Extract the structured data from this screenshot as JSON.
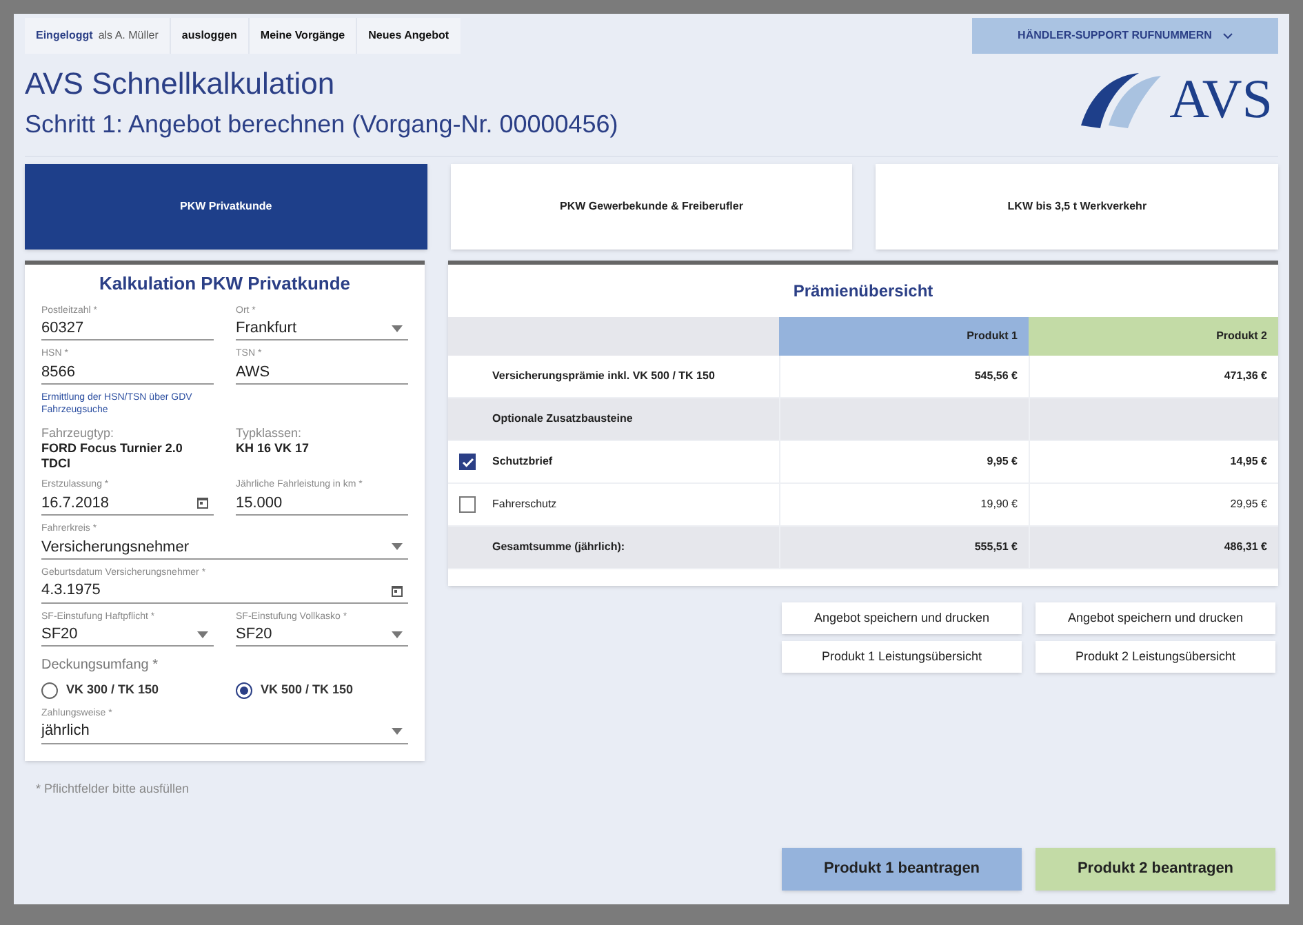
{
  "nav": {
    "logged_in_label": "Eingeloggt",
    "logged_in_user": "als A. Müller",
    "links": [
      "ausloggen",
      "Meine Vorgänge",
      "Neues Angebot"
    ],
    "support": "HÄNDLER-SUPPORT RUFNUMMERN"
  },
  "header": {
    "title": "AVS Schnellkalkulation",
    "subtitle": "Schritt 1: Angebot berechnen (Vorgang-Nr. 00000456)",
    "logo": "AVS"
  },
  "tabs": [
    {
      "label": "PKW Privatkunde",
      "selected": true
    },
    {
      "label": "PKW Gewerbekunde & Freiberufler",
      "selected": false
    },
    {
      "label": "LKW bis 3,5 t Werkverkehr",
      "selected": false
    }
  ],
  "form": {
    "title": "Kalkulation PKW Privatkunde",
    "items": [
      {
        "kind": "fields",
        "fields": [
          {
            "kind": "text",
            "label": "Postleitzahl *",
            "value": "60327"
          },
          {
            "kind": "select",
            "label": "Ort *",
            "value": "Frankfurt"
          }
        ]
      },
      {
        "kind": "fields",
        "fields": [
          {
            "kind": "text",
            "label": "HSN *",
            "value": "8566"
          },
          {
            "kind": "text",
            "label": "TSN *",
            "value": "AWS"
          }
        ]
      },
      {
        "kind": "link",
        "text": "Ermittlung der HSN/TSN über GDV Fahrzeugsuche"
      },
      {
        "kind": "info",
        "pairs": [
          {
            "label": "Fahrzeugtyp:",
            "value": "FORD Focus Turnier 2.0 TDCI"
          },
          {
            "label": "Typklassen:",
            "value": "KH 16 VK 17"
          }
        ]
      },
      {
        "kind": "fields",
        "fields": [
          {
            "kind": "date",
            "label": "Erstzulassung *",
            "value": "16.7.2018"
          },
          {
            "kind": "text",
            "label": "Jährliche Fahrleistung in km *",
            "value": "15.000"
          }
        ]
      },
      {
        "kind": "fields",
        "fields": [
          {
            "kind": "select",
            "label": "Fahrerkreis *",
            "value": "Versicherungsnehmer"
          }
        ]
      },
      {
        "kind": "fields",
        "fields": [
          {
            "kind": "date",
            "label": "Geburtsdatum Versicherungsnehmer *",
            "value": "4.3.1975"
          }
        ]
      },
      {
        "kind": "fields",
        "fields": [
          {
            "kind": "select",
            "label": "SF-Einstufung Haftpflicht *",
            "value": "SF20"
          },
          {
            "kind": "select",
            "label": "SF-Einstufung Vollkasko *",
            "value": "SF20"
          }
        ]
      },
      {
        "kind": "radio",
        "label": "Deckungsumfang *",
        "options": [
          {
            "label": "VK 300 / TK 150",
            "selected": false
          },
          {
            "label": "VK 500 / TK 150",
            "selected": true
          }
        ]
      },
      {
        "kind": "fields",
        "fields": [
          {
            "kind": "select",
            "label": "Zahlungsweise *",
            "value": "jährlich"
          }
        ]
      }
    ]
  },
  "footnote": "* Pflichtfelder bitte ausfüllen",
  "premium": {
    "title": "Prämienübersicht",
    "columns": [
      {
        "label": "Produkt 1",
        "color": "#95b3dc"
      },
      {
        "label": "Produkt 2",
        "color": "#c3dba6"
      }
    ],
    "rows": [
      {
        "kind": "main",
        "label": "Versicherungsprämie inkl. VK 500 / TK 150",
        "values": [
          "545,56 €",
          "471,36 €"
        ]
      },
      {
        "kind": "section",
        "label": "Optionale Zusatzbausteine"
      },
      {
        "kind": "option",
        "label": "Schutzbrief",
        "checked": true,
        "values": [
          "9,95 €",
          "14,95 €"
        ]
      },
      {
        "kind": "option",
        "label": "Fahrerschutz",
        "checked": false,
        "values": [
          "19,90 €",
          "29,95 €"
        ]
      },
      {
        "kind": "total",
        "label": "Gesamtsumme (jährlich):",
        "values": [
          "555,51 €",
          "486,31 €"
        ]
      }
    ]
  },
  "actions": [
    [
      "Angebot speichern und drucken",
      "Angebot speichern und drucken"
    ],
    [
      "Produkt 1 Leistungsübersicht",
      "Produkt 2 Leistungsübersicht"
    ]
  ],
  "apply": [
    {
      "label": "Produkt 1 beantragen",
      "color": "#95b3dc"
    },
    {
      "label": "Produkt 2 beantragen",
      "color": "#c3dba6"
    }
  ]
}
